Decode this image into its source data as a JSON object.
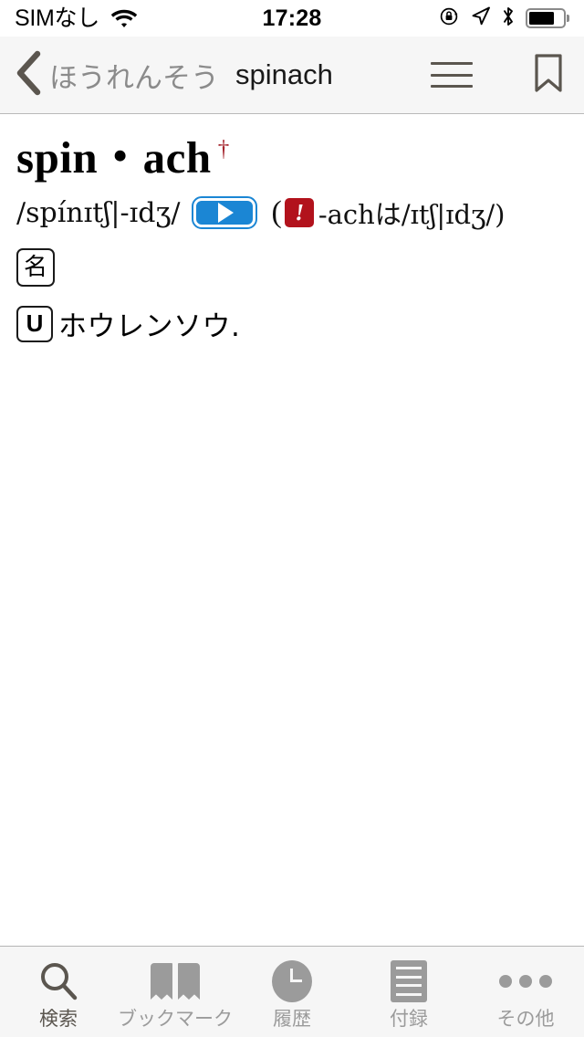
{
  "status_bar": {
    "carrier": "SIMなし",
    "time": "17:28",
    "wifi_icon": "wifi-icon",
    "rotation_lock_icon": "rotation-lock-icon",
    "location_icon": "location-arrow-icon",
    "bluetooth_icon": "bluetooth-icon",
    "battery_icon": "battery-icon",
    "battery_level_percent": 75
  },
  "nav_bar": {
    "back_icon": "chevron-left-icon",
    "kana_reading": "ほうれんそう",
    "word": "spinach",
    "menu_icon": "hamburger-menu-icon",
    "bookmark_icon": "bookmark-icon"
  },
  "entry": {
    "headword": "spin・ach",
    "dagger": "†",
    "dagger_color": "#a4242c",
    "ipa": "/spínɪtʃ|-ɪdʒ/",
    "play_icon": "play-audio-icon",
    "note_open_paren": "(",
    "warning_badge": "!",
    "warning_badge_color": "#b2121c",
    "note_text": "-achは/ɪtʃ|ɪdʒ/)",
    "part_of_speech": "名",
    "countability": "U",
    "definition": "ホウレンソウ."
  },
  "tab_bar": {
    "selected_index": 0,
    "selected_color": "#5b564f",
    "unselected_color": "#9b9b9b",
    "items": [
      {
        "label": "検索",
        "icon": "search-icon"
      },
      {
        "label": "ブックマーク",
        "icon": "book-icon"
      },
      {
        "label": "履歴",
        "icon": "clock-icon"
      },
      {
        "label": "付録",
        "icon": "document-lines-icon"
      },
      {
        "label": "その他",
        "icon": "ellipsis-icon"
      }
    ]
  }
}
